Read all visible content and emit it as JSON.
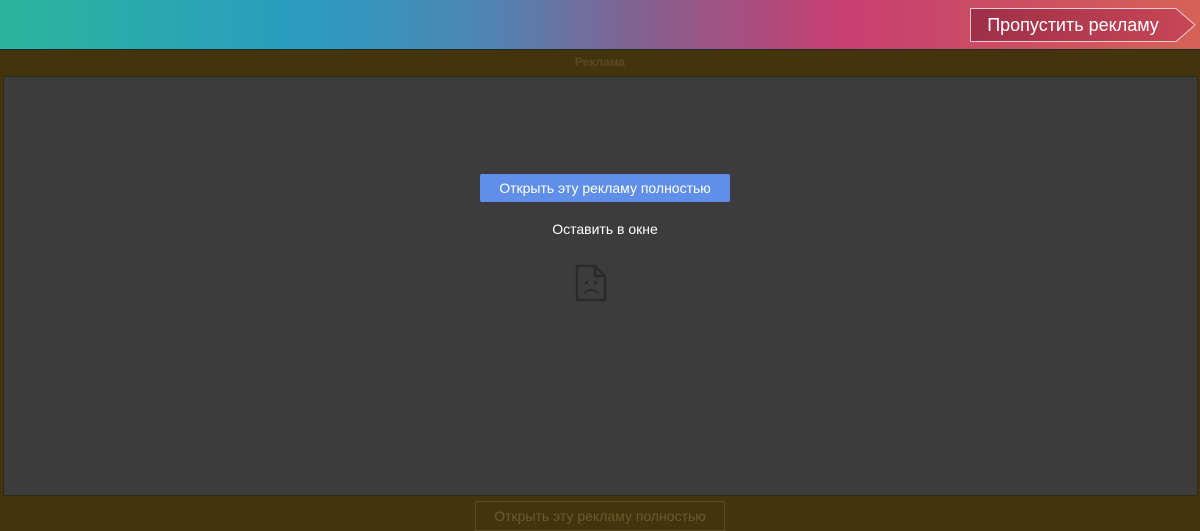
{
  "header": {
    "skip_ad_label": "Пропустить рекламу"
  },
  "ad": {
    "caption": "Реклама",
    "open_full_label": "Открыть эту рекламу полностью",
    "stay_in_window_label": "Оставить в окне",
    "error_icon": "sad-file-icon"
  },
  "footer": {
    "open_full_label": "Открыть эту рекламу полностью"
  },
  "colors": {
    "accent_button": "#5f8fe8",
    "frame_background": "#3c3c3c",
    "page_background": "#44340d"
  }
}
